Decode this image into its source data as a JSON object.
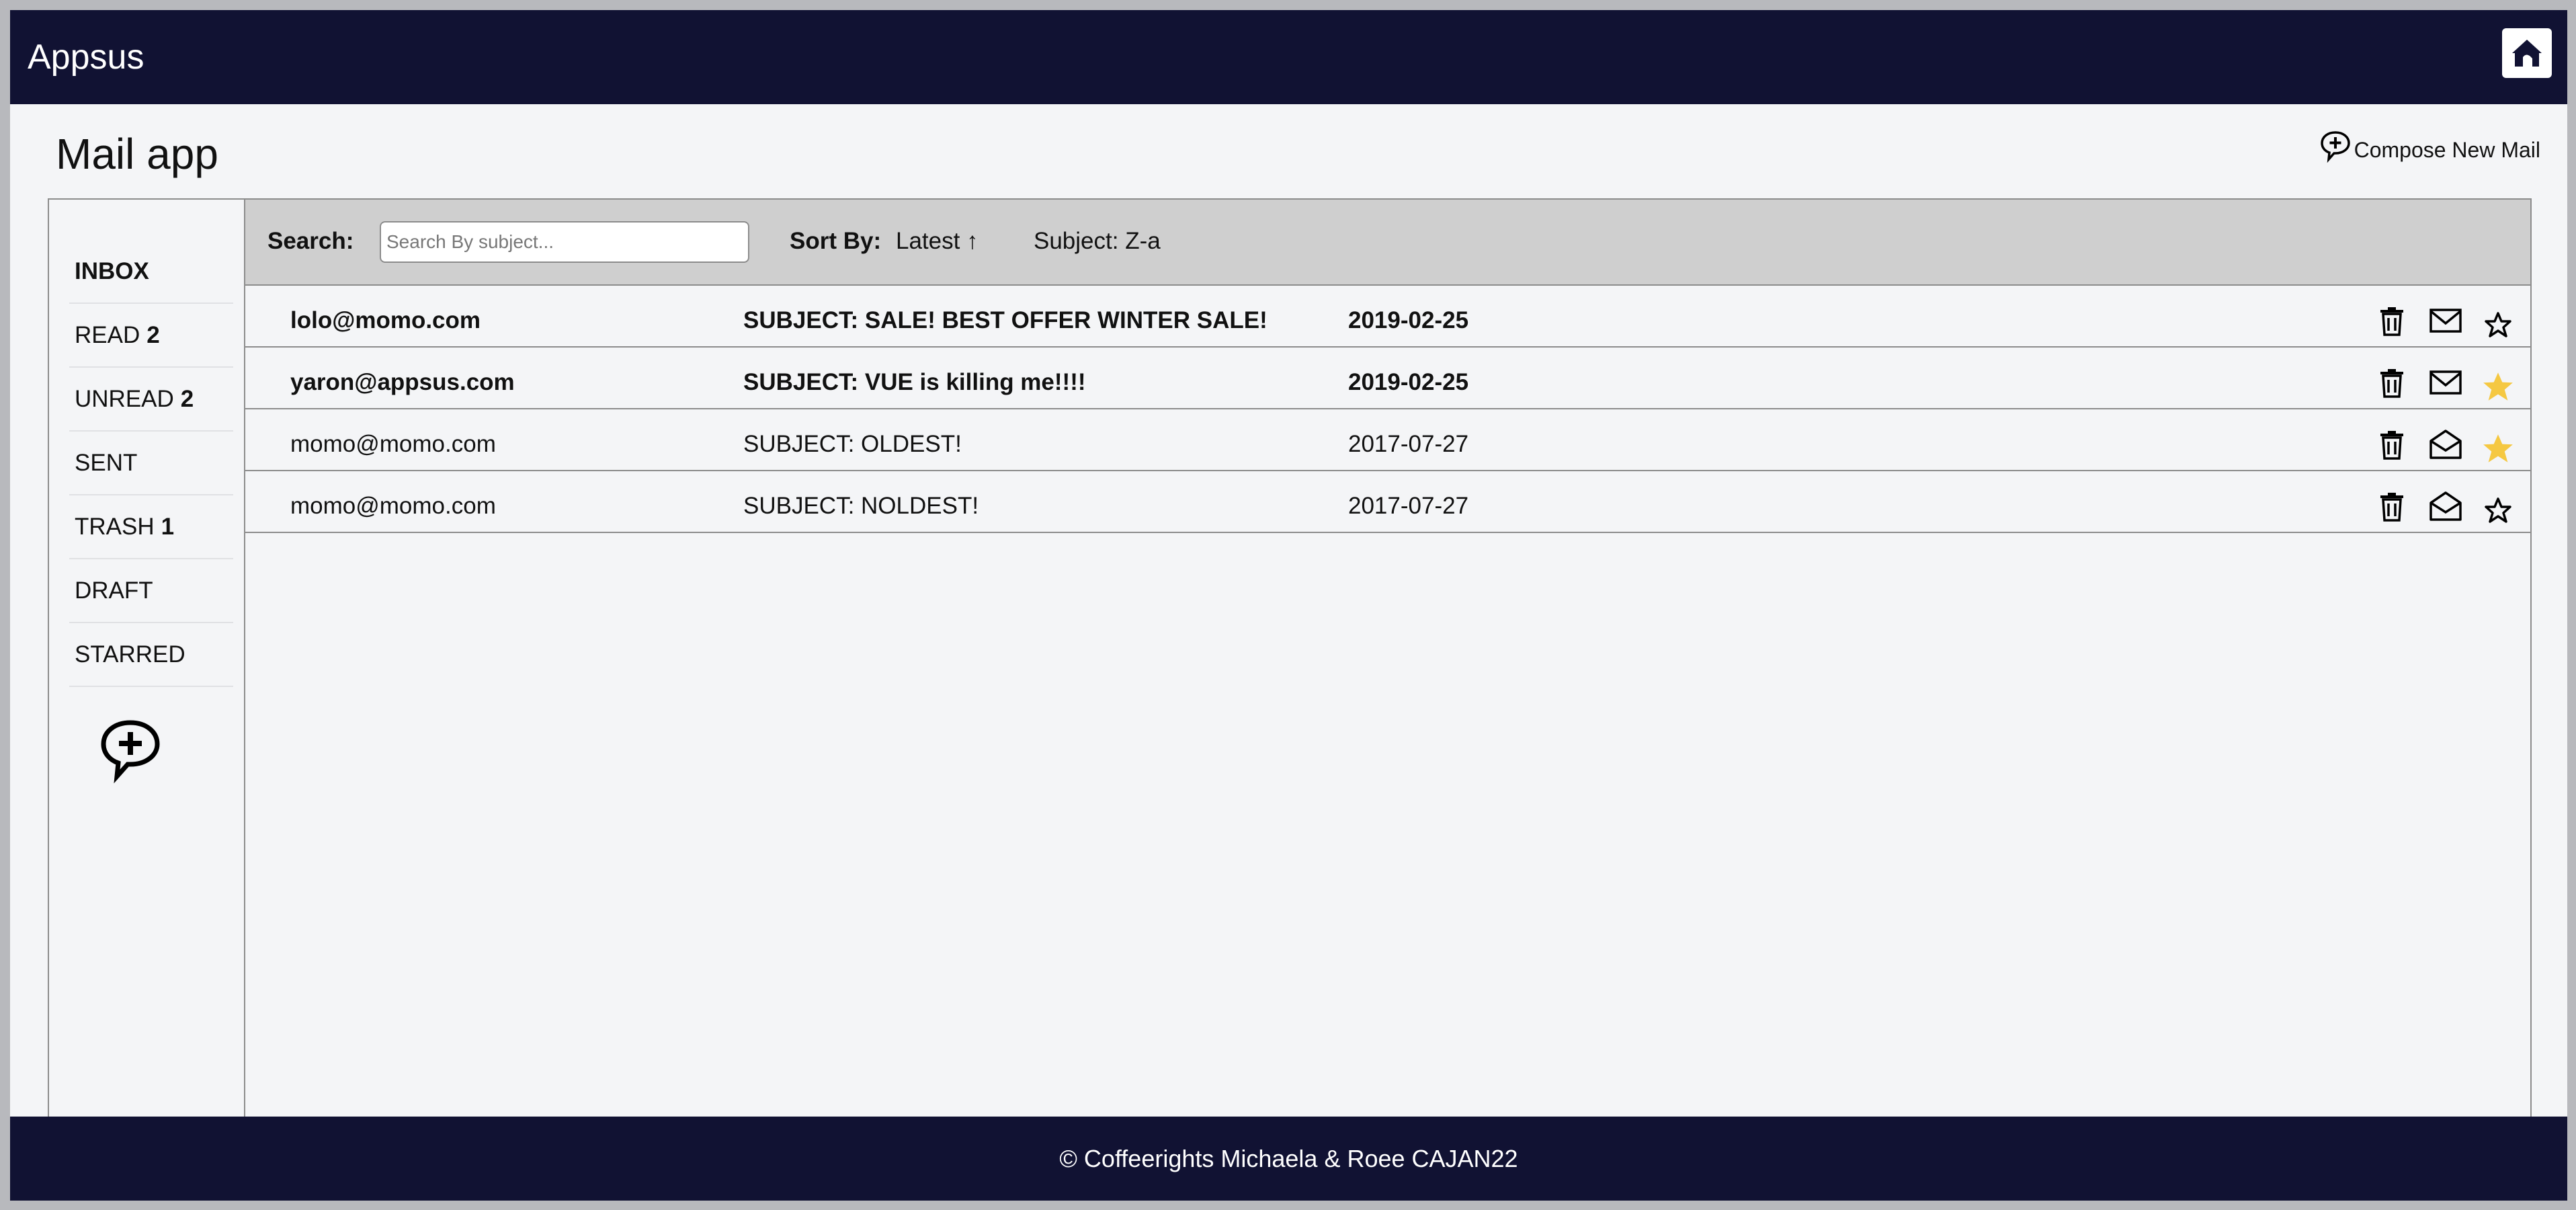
{
  "app": {
    "brand": "Appsus",
    "home_icon": "home-icon"
  },
  "page": {
    "title": "Mail app",
    "compose_label": "Compose New Mail",
    "compose_icon": "compose-bubble-icon"
  },
  "sidebar": {
    "folders": [
      {
        "label": "INBOX",
        "count": "",
        "active": true
      },
      {
        "label": "READ",
        "count": "2",
        "active": false
      },
      {
        "label": "UNREAD",
        "count": "2",
        "active": false
      },
      {
        "label": "SENT",
        "count": "",
        "active": false
      },
      {
        "label": "TRASH",
        "count": "1",
        "active": false
      },
      {
        "label": "DRAFT",
        "count": "",
        "active": false
      },
      {
        "label": "STARRED",
        "count": "",
        "active": false
      }
    ],
    "compose_icon": "compose-bubble-icon"
  },
  "filter": {
    "search_label": "Search:",
    "search_placeholder": "Search By subject...",
    "search_value": "",
    "sort_label": "Sort By:",
    "sort_date": "Latest ↑",
    "sort_subject": "Subject: Z-a"
  },
  "mails": [
    {
      "from": "lolo@momo.com",
      "subject": "SUBJECT: SALE! BEST OFFER WINTER SALE!",
      "date": "2019-02-25",
      "unread": true,
      "starred": false
    },
    {
      "from": "yaron@appsus.com",
      "subject": "SUBJECT: VUE is killing me!!!!",
      "date": "2019-02-25",
      "unread": true,
      "starred": true
    },
    {
      "from": "momo@momo.com",
      "subject": "SUBJECT: OLDEST!",
      "date": "2017-07-27",
      "unread": false,
      "starred": true
    },
    {
      "from": "momo@momo.com",
      "subject": "SUBJECT: NOLDEST!",
      "date": "2017-07-27",
      "unread": false,
      "starred": false
    }
  ],
  "footer": {
    "text": "© Coffeerights Michaela & Roee CAJAN22"
  },
  "colors": {
    "header_bg": "#111233",
    "star_active": "#f5c842",
    "filter_bg": "#cfcfcf"
  }
}
